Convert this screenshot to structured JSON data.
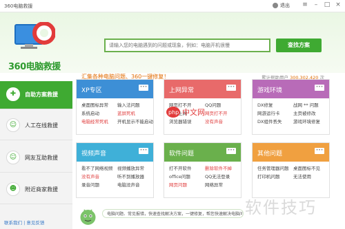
{
  "window": {
    "title": "360电脑救援",
    "user": "退出"
  },
  "header": {
    "logo_text": "360电脑救援",
    "search_placeholder": "请输入您的电脑遇到的问题或现象，例如：电脑开机很慢",
    "search_button": "查找方案",
    "tagline": "汇集各种电脑问题、360一键修复！",
    "count_prefix": "累计帮助用户",
    "count_value": "300,302,420",
    "count_suffix": "次"
  },
  "sidebar": [
    {
      "label": "自助方案救援",
      "icon": "✚"
    },
    {
      "label": "人工在线救援",
      "icon": "☺"
    },
    {
      "label": "网友互助救援",
      "icon": "☺"
    },
    {
      "label": "附近商家救援",
      "icon": "☻"
    }
  ],
  "cards": [
    {
      "title": "XP专区",
      "color": "#3d8fd6",
      "items": [
        [
          "桌面图标异常",
          "输入法问题"
        ],
        [
          "系统启动",
          "蓝屏死机"
        ],
        [
          "电脑经常死机",
          "开机显示不能启动"
        ]
      ]
    },
    {
      "title": "上网异常",
      "color": "#e86a6a",
      "items": [
        [
          "网页打不开",
          "QQ问题"
        ],
        [
          "无法上网",
          "网页打不开"
        ],
        [
          "浏览器错误",
          "没有声音"
        ]
      ]
    },
    {
      "title": "游戏环境",
      "color": "#b86bb8",
      "items": [
        [
          "DX修复",
          "战网 ** 问题"
        ],
        [
          "网游运行卡",
          "主页被修改"
        ],
        [
          "DX组件丢失",
          "游戏环境修复"
        ]
      ]
    },
    {
      "title": "视频声音",
      "color": "#3fb0d8",
      "items": [
        [
          "看不了网络视频",
          "视频播放异常"
        ],
        [
          "没有声音",
          "听不到播放器"
        ],
        [
          "录音问题",
          "电脑没声音"
        ]
      ]
    },
    {
      "title": "软件问题",
      "color": "#6ab04c",
      "items": [
        [
          "打不开软件",
          "删除软件不掉"
        ],
        [
          "office问题",
          "QQ无法登录"
        ],
        [
          "网页问题",
          "网络异常"
        ]
      ]
    },
    {
      "title": "其他问题",
      "color": "#f0a040",
      "items": [
        [
          "任务管理器问题",
          "桌面图标不见"
        ],
        [
          "打印机问题",
          "无法使用"
        ],
        [
          "",
          ""
        ]
      ]
    }
  ],
  "footer": {
    "bubble_text": "电脑问题、常见报错，快速查找解决方案，一键修复，帮您快速解决电脑问题哦！",
    "link": "联系我们 | 意见反馈",
    "watermark": "软件技巧"
  },
  "colors": {
    "accent": "#3faa32",
    "highlight": "#e06b00"
  }
}
